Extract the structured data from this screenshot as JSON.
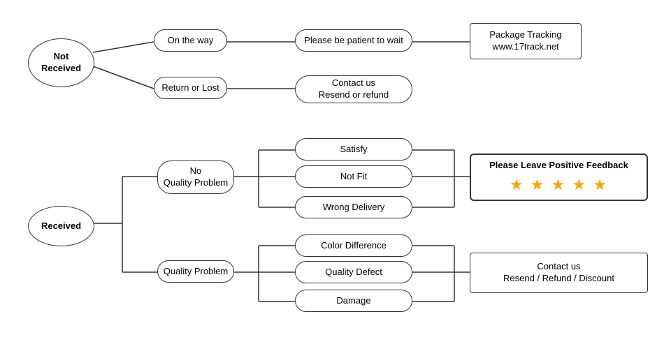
{
  "nodes": {
    "not_received": {
      "label": "Not\nReceived"
    },
    "on_the_way": {
      "label": "On the way"
    },
    "return_or_lost": {
      "label": "Return or Lost"
    },
    "please_be_patient": {
      "label": "Please be patient to wait"
    },
    "package_tracking": {
      "label": "Package Tracking\nwww.17track.net"
    },
    "contact_resend_refund": {
      "label": "Contact us\nResend or refund"
    },
    "received": {
      "label": "Received"
    },
    "no_quality_problem": {
      "label": "No\nQuality Problem"
    },
    "quality_problem": {
      "label": "Quality Problem"
    },
    "satisfy": {
      "label": "Satisfy"
    },
    "not_fit": {
      "label": "Not Fit"
    },
    "wrong_delivery": {
      "label": "Wrong Delivery"
    },
    "color_difference": {
      "label": "Color Difference"
    },
    "quality_defect": {
      "label": "Quality Defect"
    },
    "damage": {
      "label": "Damage"
    },
    "please_leave_feedback": {
      "label": "Please Leave Positive Feedback"
    },
    "stars": {
      "label": "★ ★ ★ ★ ★"
    },
    "contact_resend_refund_discount": {
      "label": "Contact us\nResend / Refund / Discount"
    }
  }
}
